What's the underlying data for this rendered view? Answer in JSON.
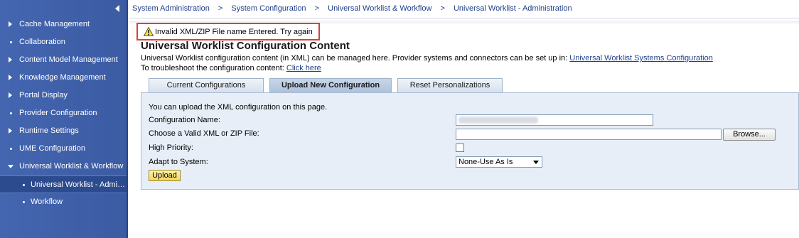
{
  "sidebar": {
    "items": [
      {
        "label": "Cache Management",
        "marker": "triangle-right"
      },
      {
        "label": "Collaboration",
        "marker": "dot"
      },
      {
        "label": "Content Model Management",
        "marker": "triangle-right"
      },
      {
        "label": "Knowledge Management",
        "marker": "triangle-right"
      },
      {
        "label": "Portal Display",
        "marker": "triangle-right"
      },
      {
        "label": "Provider Configuration",
        "marker": "dot"
      },
      {
        "label": "Runtime Settings",
        "marker": "triangle-right"
      },
      {
        "label": "UME Configuration",
        "marker": "dot"
      },
      {
        "label": "Universal Worklist & Workflow",
        "marker": "triangle-down"
      },
      {
        "label": "Universal Worklist - Admin...",
        "marker": "dot",
        "selected": true
      },
      {
        "label": "Workflow",
        "marker": "dot"
      }
    ]
  },
  "breadcrumb": {
    "items": [
      "System Administration",
      "System Configuration",
      "Universal Worklist & Workflow",
      "Universal Worklist - Administration"
    ],
    "separator": ">"
  },
  "alert": {
    "message": "Invalid XML/ZIP File name Entered. Try again"
  },
  "page": {
    "title": "Universal Worklist Configuration Content",
    "description_prefix": "Universal Worklist configuration content (in XML) can be managed here. Provider systems and connectors can be set up in:",
    "systems_link": "Universal Worklist Systems Configuration",
    "troubleshoot_prefix": "To troubleshoot the configuration content:",
    "troubleshoot_link": "Click here"
  },
  "tabs": [
    {
      "label": "Current Configurations"
    },
    {
      "label": "Upload New Configuration",
      "active": true
    },
    {
      "label": "Reset Personalizations"
    }
  ],
  "form": {
    "intro": "You can upload the XML configuration on this page.",
    "config_name_label": "Configuration Name:",
    "file_label": "Choose a Valid XML or ZIP File:",
    "browse_label": "Browse...",
    "priority_label": "High Priority:",
    "high_priority_checked": false,
    "system_label": "Adapt to System:",
    "system_selected": "None-Use As Is",
    "upload_label": "Upload"
  },
  "colors": {
    "sidebar": "#3d5fa8",
    "link": "#1f3f8a",
    "alert_border": "#d9403a",
    "panel": "#e7eef7",
    "upload_button": "#f3d760"
  }
}
